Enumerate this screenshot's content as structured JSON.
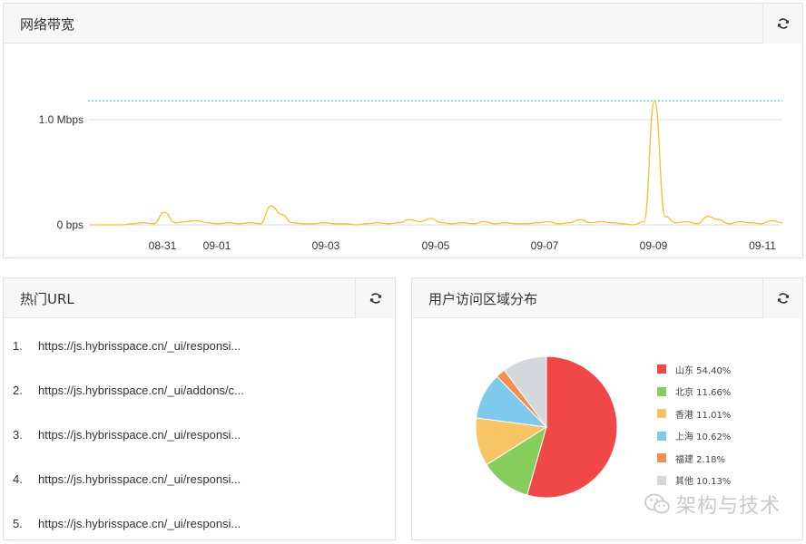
{
  "bandwidth": {
    "title": "网络带宽",
    "refresh_icon": "refresh-icon",
    "y_ticks": [
      "1.0 Mbps",
      "0 bps"
    ],
    "x_ticks": [
      "08-31",
      "09-01",
      "09-03",
      "09-05",
      "09-07",
      "09-09",
      "09-11"
    ],
    "colors": {
      "line": "#f2c230",
      "peak_ref": "#5bc0de",
      "grid": "#dddddd"
    }
  },
  "chart_data": [
    {
      "type": "line",
      "title": "",
      "xlabel": "",
      "ylabel": "",
      "y_unit": "Mbps",
      "ylim": [
        0,
        1.25
      ],
      "y_ticks": [
        0,
        1.0
      ],
      "x_ticks": [
        "08-31",
        "09-01",
        "09-03",
        "09-05",
        "09-07",
        "09-09",
        "09-11"
      ],
      "reference_line": 1.18,
      "series": [
        {
          "values": [
            0.0,
            0.0,
            0.0,
            0.0,
            0.01,
            0.02,
            0.01,
            0.12,
            0.02,
            0.03,
            0.04,
            0.02,
            0.01,
            0.02,
            0.01,
            0.02,
            0.01,
            0.18,
            0.1,
            0.02,
            0.01,
            0.01,
            0.02,
            0.01,
            0.01,
            0.0,
            0.01,
            0.02,
            0.01,
            0.02,
            0.05,
            0.03,
            0.06,
            0.02,
            0.01,
            0.02,
            0.01,
            0.03,
            0.01,
            0.02,
            0.01,
            0.01,
            0.02,
            0.03,
            0.01,
            0.02,
            0.05,
            0.02,
            0.03,
            0.02,
            0.01,
            0.0,
            0.03,
            1.18,
            0.08,
            0.02,
            0.03,
            0.01,
            0.08,
            0.05,
            0.01,
            0.03,
            0.02,
            0.01,
            0.04,
            0.02
          ]
        }
      ]
    },
    {
      "type": "pie",
      "title": "",
      "categories": [
        "山东 54.40%",
        "北京 11.66%",
        "香港 11.01%",
        "上海 10.62%",
        "福建 2.18%",
        "其他 10.13%"
      ],
      "values": [
        54.4,
        11.66,
        11.01,
        10.62,
        2.18,
        10.13
      ],
      "colors": [
        "#f04848",
        "#87cd5c",
        "#f7c565",
        "#7ec9ec",
        "#f28e4f",
        "#d4d8dc"
      ],
      "legend": "right"
    }
  ],
  "hot_urls": {
    "title": "热门URL",
    "refresh_icon": "refresh-icon",
    "items": [
      {
        "num": "1.",
        "url": "https://js.hybrisspace.cn/_ui/responsi..."
      },
      {
        "num": "2.",
        "url": "https://js.hybrisspace.cn/_ui/addons/c..."
      },
      {
        "num": "3.",
        "url": "https://js.hybrisspace.cn/_ui/responsi..."
      },
      {
        "num": "4.",
        "url": "https://js.hybrisspace.cn/_ui/responsi..."
      },
      {
        "num": "5.",
        "url": "https://js.hybrisspace.cn/_ui/responsi..."
      }
    ]
  },
  "geo": {
    "title": "用户访问区域分布",
    "refresh_icon": "refresh-icon",
    "legend": [
      {
        "label": "山东 54.40%",
        "color": "#f04848"
      },
      {
        "label": "北京 11.66%",
        "color": "#87cd5c"
      },
      {
        "label": "香港 11.01%",
        "color": "#f7c565"
      },
      {
        "label": "上海 10.62%",
        "color": "#7ec9ec"
      },
      {
        "label": "福建 2.18%",
        "color": "#f28e4f"
      },
      {
        "label": "其他 10.13%",
        "color": "#d4d8dc"
      }
    ]
  },
  "watermark": {
    "text": "架构与技术",
    "icon": "wechat-icon"
  }
}
